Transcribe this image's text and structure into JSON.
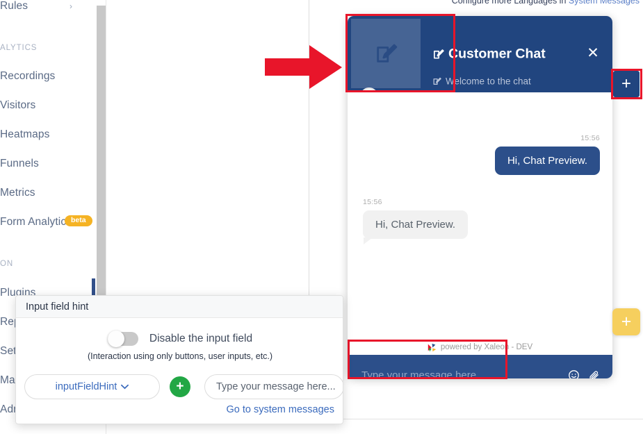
{
  "sidebar": {
    "items": [
      {
        "label": "Rules",
        "chevron": "›"
      },
      {
        "label": "Recordings"
      },
      {
        "label": "Visitors"
      },
      {
        "label": "Heatmaps"
      },
      {
        "label": "Funnels"
      },
      {
        "label": "Metrics"
      },
      {
        "label": "Form Analytics",
        "badge": "beta"
      },
      {
        "label": "Plugins"
      },
      {
        "label": "Rep"
      },
      {
        "label": "Set"
      },
      {
        "label": "Mar"
      },
      {
        "label": "Adm"
      }
    ],
    "sections": [
      {
        "label": "ALYTICS"
      },
      {
        "label": "ON"
      }
    ]
  },
  "top_note": {
    "text": "Configure more Languages in ",
    "link": "System Messages"
  },
  "widget": {
    "title": "Customer Chat",
    "subtitle": "Welcome to the chat",
    "close_label": "✕",
    "messages": [
      {
        "time": "15:56",
        "text": "Hi, Chat Preview.",
        "side": "outgoing"
      },
      {
        "time": "15:56",
        "text": "Hi, Chat Preview.",
        "side": "incoming"
      }
    ],
    "powered_by": "powered by Xaleon - DEV",
    "input_placeholder": "Type your message here...",
    "emoji_icon": "☺",
    "attach_icon": "attachment-icon"
  },
  "floating": {
    "plus_dark": "+",
    "plus_yellow": "+"
  },
  "dialog": {
    "title": "Input field hint",
    "toggle_label": "Disable the input field",
    "toggle_state": "off",
    "hint": "(Interaction using only buttons, user inputs, etc.)",
    "select_value": "inputFieldHint",
    "add_button": "+",
    "input_value": "Type your message here...",
    "link": "Go to system messages"
  },
  "colors": {
    "widget_header": "#21457f",
    "bubble_out": "#2c4f8a",
    "bubble_in": "#f1f1f1",
    "annotation": "#e8152a",
    "accent_yellow": "#f6cf5e",
    "accent_green": "#22a745",
    "link_blue": "#3b6bbd",
    "beta_badge": "#f5b324"
  }
}
